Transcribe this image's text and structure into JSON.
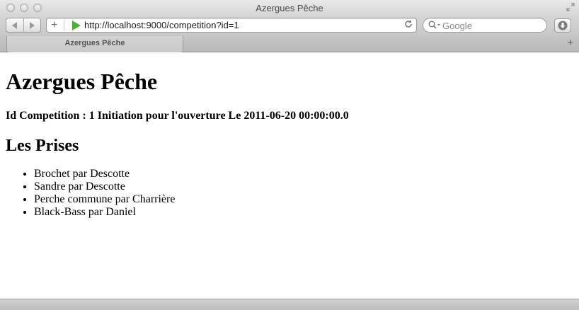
{
  "window": {
    "title": "Azergues Pêche"
  },
  "toolbar": {
    "url": "http://localhost:9000/competition?id=1",
    "search_placeholder": "Google"
  },
  "tabs": [
    {
      "label": "Azergues Pêche"
    }
  ],
  "page": {
    "heading": "Azergues Pêche",
    "competition_line": "Id Competition : 1 Initiation pour l'ouverture Le 2011-06-20 00:00:00.0",
    "section_title": "Les Prises",
    "catches": [
      "Brochet par Descotte",
      "Sandre par Descotte",
      "Perche commune par Charrière",
      "Black-Bass par Daniel"
    ]
  },
  "colors": {
    "go_arrow": "#4caf3a"
  }
}
